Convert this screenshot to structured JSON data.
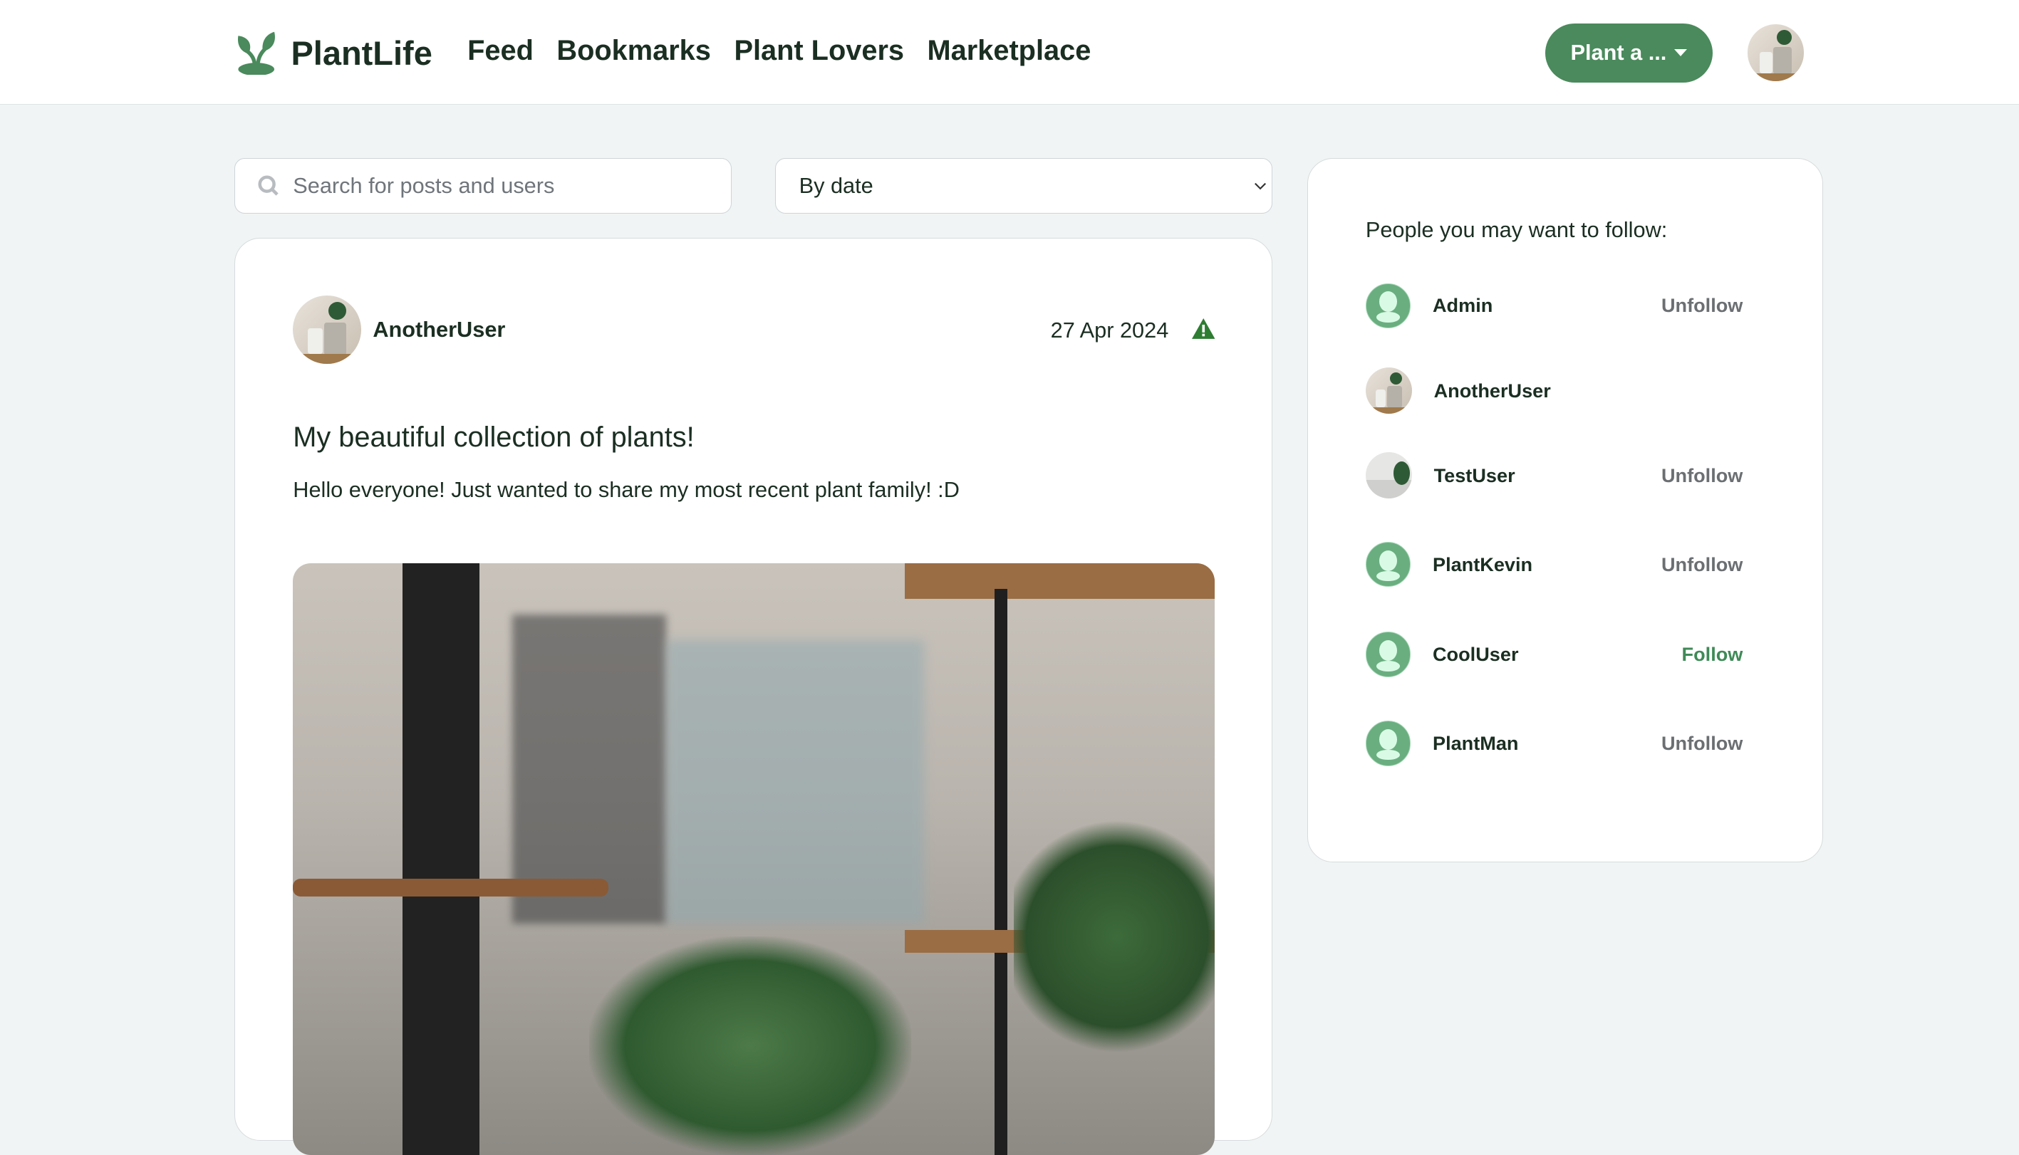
{
  "header": {
    "brand": "PlantLife",
    "nav": [
      "Feed",
      "Bookmarks",
      "Plant Lovers",
      "Marketplace"
    ],
    "create_button": "Plant a ..."
  },
  "filters": {
    "search_placeholder": "Search for posts and users",
    "sort_selected": "By date"
  },
  "post": {
    "author": "AnotherUser",
    "date": "27 Apr 2024",
    "title": "My beautiful collection of plants!",
    "body": "Hello everyone! Just wanted to share my most recent plant family! :D"
  },
  "suggestions": {
    "heading": "People you may want to follow:",
    "users": [
      {
        "name": "Admin",
        "action": "Unfollow"
      },
      {
        "name": "AnotherUser",
        "action": ""
      },
      {
        "name": "TestUser",
        "action": "Unfollow"
      },
      {
        "name": "PlantKevin",
        "action": "Unfollow"
      },
      {
        "name": "CoolUser",
        "action": "Follow"
      },
      {
        "name": "PlantMan",
        "action": "Unfollow"
      }
    ]
  },
  "colors": {
    "brand": "#4a8a5c",
    "background": "#f0f4f4",
    "warning": "#2e7d32"
  }
}
